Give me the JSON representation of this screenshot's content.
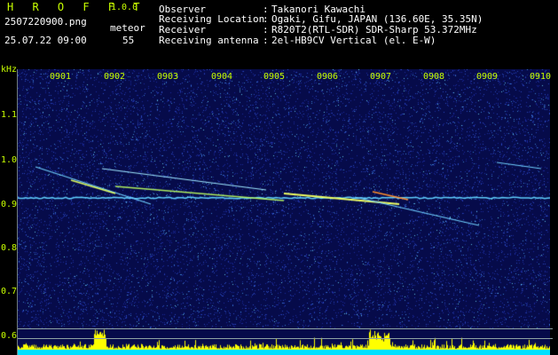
{
  "header": {
    "app_title": "H R O F F T",
    "app_version": "1.0.0",
    "file_name": "2507220900.png",
    "date_time": "25.07.22 09:00",
    "meteor_label": "meteor",
    "meteor_count": "55"
  },
  "info": [
    {
      "label": "Observer",
      "value": "Takanori Kawachi"
    },
    {
      "label": "Receiving Location",
      "value": "Ogaki, Gifu, JAPAN (136.60E, 35.35N)"
    },
    {
      "label": "Receiver",
      "value": "R820T2(RTL-SDR) SDR-Sharp 53.372MHz"
    },
    {
      "label": "Receiving antenna",
      "value": "2el-HB9CV Vertical (el. E-W)"
    }
  ],
  "separator": ":",
  "axes": {
    "unit": "kHz",
    "x_ticks": [
      "0901",
      "0902",
      "0903",
      "0904",
      "0905",
      "0906",
      "0907",
      "0908",
      "0909",
      "0910"
    ],
    "y_ticks": [
      "1.1",
      "1.0",
      "0.9",
      "0.8",
      "0.7",
      "0.6"
    ]
  },
  "colors": {
    "header_text": "#c8ff00",
    "background_noise": "#0a1060",
    "carrier": "#60d0ff",
    "meteor_trail": "#f0ff60",
    "level_bar": "#ffff00",
    "level_base": "#00e0ff"
  }
}
